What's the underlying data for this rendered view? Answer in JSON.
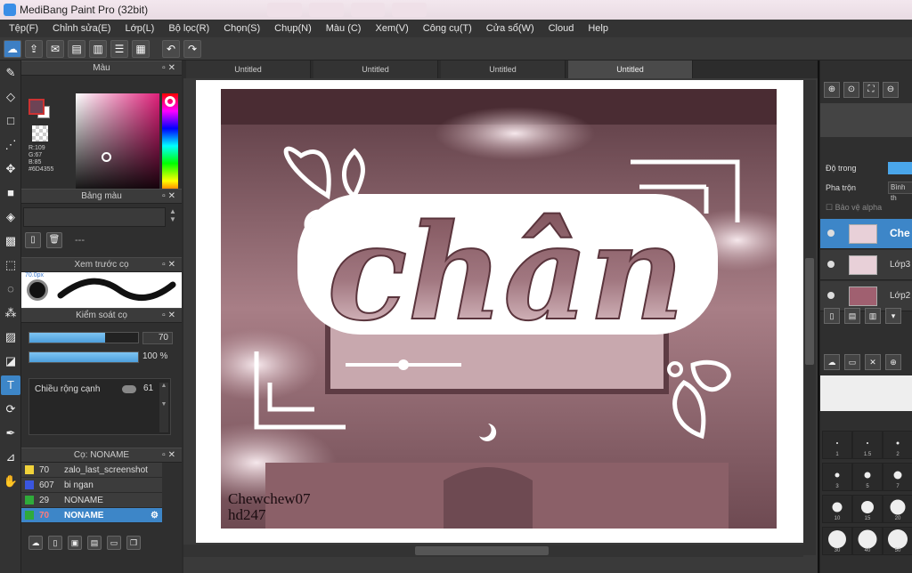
{
  "window": {
    "title": "MediBang Paint Pro (32bit)"
  },
  "menu": [
    "Tệp(F)",
    "Chỉnh sửa(E)",
    "Lớp(L)",
    "Bộ lọc(R)",
    "Chọn(S)",
    "Chụp(N)",
    "Màu (C)",
    "Xem(V)",
    "Công cụ(T)",
    "Cửa sổ(W)",
    "Cloud",
    "Help"
  ],
  "color_panel": {
    "title": "Màu",
    "r": "R:109",
    "g": "G:67",
    "b": "B:85",
    "hex": "#6D4355"
  },
  "palette_panel": {
    "title": "Bảng màu",
    "empty": "---"
  },
  "brush_preview_panel": {
    "title": "Xem trước cọ",
    "size": "70.0px"
  },
  "brush_control_panel": {
    "title": "Kiểm soát cọ",
    "size_value": "70",
    "opacity_value": "100",
    "opacity_unit": "%",
    "edge_label": "Chiều rộng cạnh",
    "edge_value": "61"
  },
  "brush_list_panel": {
    "title": "Cọ: NONAME",
    "items": [
      {
        "num": "70",
        "name": "zalo_last_screenshot",
        "color": "#f0d23a"
      },
      {
        "num": "607",
        "name": "bi ngan",
        "color": "#3a56e0"
      },
      {
        "num": "29",
        "name": "NONAME",
        "color": "#2faa3a"
      },
      {
        "num": "70",
        "name": "NONAME",
        "color": "#2faa3a"
      }
    ]
  },
  "doc_tabs": [
    "Untitled",
    "Untitled",
    "Untitled",
    "Untitled"
  ],
  "artwork": {
    "title_text": "chân",
    "signature_line1": "Chewchew07",
    "signature_line2": "hd247"
  },
  "layer_panel": {
    "opacity_label": "Độ trong",
    "blend_label": "Pha trộn",
    "blend_value": "Bình th",
    "protect_alpha": "Bảo vệ alpha",
    "layers": [
      {
        "name": "Che",
        "selected": true
      },
      {
        "name": "Lớp3",
        "selected": false
      },
      {
        "name": "Lớp2",
        "selected": false
      }
    ]
  },
  "brush_sizes": [
    "1",
    "1.5",
    "2",
    "3",
    "5",
    "7",
    "10",
    "15",
    "20",
    "30",
    "40",
    "50"
  ]
}
